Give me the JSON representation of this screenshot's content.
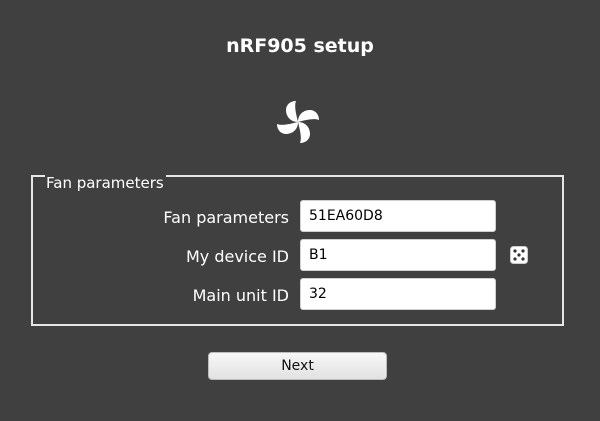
{
  "header": {
    "title": "nRF905 setup",
    "logo_icon": "fan-icon"
  },
  "form": {
    "group_title": "Fan parameters",
    "fields": [
      {
        "label": "Fan parameters",
        "value": "51EA60D8"
      },
      {
        "label": "My device ID",
        "value": "B1",
        "action_icon": "dice-icon"
      },
      {
        "label": "Main unit ID",
        "value": "32"
      }
    ]
  },
  "actions": {
    "next_label": "Next"
  },
  "colors": {
    "background": "#404040",
    "text": "#ffffff",
    "input_background": "#ffffff",
    "button_background": "#eeeeee"
  }
}
